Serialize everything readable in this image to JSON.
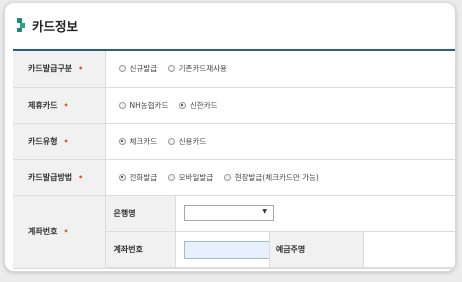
{
  "section": {
    "title": "카드정보"
  },
  "rows": [
    {
      "label": "카드발급구분",
      "options": [
        {
          "label": "신규발급",
          "checked": false
        },
        {
          "label": "기존카드재사용",
          "checked": false
        }
      ]
    },
    {
      "label": "제휴카드",
      "options": [
        {
          "label": "NH농협카드",
          "checked": false
        },
        {
          "label": "신한카드",
          "checked": true
        }
      ]
    },
    {
      "label": "카드유형",
      "options": [
        {
          "label": "체크카드",
          "checked": true
        },
        {
          "label": "신용카드",
          "checked": false
        }
      ]
    },
    {
      "label": "카드발급방법",
      "options": [
        {
          "label": "전화발급",
          "checked": true
        },
        {
          "label": "모바일발급",
          "checked": false
        },
        {
          "label": "현장발급(체크카드만 가능)",
          "checked": false
        }
      ]
    }
  ],
  "account": {
    "label": "계좌번호",
    "bank_label": "은행명",
    "bank_value": "",
    "number_label": "계좌번호",
    "number_value": "",
    "holder_label": "예금주명"
  },
  "required_mark": "•",
  "colors": {
    "accent": "#29607a",
    "required": "#e05a2a",
    "input_bg": "#e8f1fb"
  }
}
